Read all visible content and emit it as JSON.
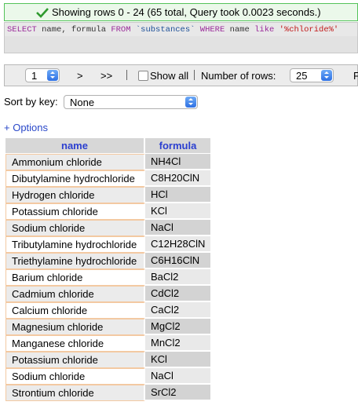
{
  "success": {
    "message": "Showing rows 0 - 24 (65 total, Query took 0.0023 seconds.)"
  },
  "sql": {
    "k_select": "SELECT",
    "fields": " name, formula ",
    "k_from": "FROM",
    "table": " `substances` ",
    "k_where": "WHERE",
    "col": " name ",
    "k_like": "like",
    "pattern": " '%chloride%'"
  },
  "nav": {
    "page": "1",
    "next": ">",
    "last": ">>",
    "show_all": "Show all",
    "rows_label": "Number of rows:",
    "rows_value": "25",
    "cut_label": "F"
  },
  "sort": {
    "label": "Sort by key:",
    "value": "None"
  },
  "options_link": "+ Options",
  "table": {
    "headers": [
      "name",
      "formula"
    ],
    "rows": [
      [
        "Ammonium chloride",
        "NH4Cl"
      ],
      [
        "Dibutylamine hydrochloride",
        "C8H20ClN"
      ],
      [
        "Hydrogen chloride",
        "HCl"
      ],
      [
        "Potassium chloride",
        "KCl"
      ],
      [
        "Sodium chloride",
        "NaCl"
      ],
      [
        "Tributylamine hydrochloride",
        "C12H28ClN"
      ],
      [
        "Triethylamine hydrochloride",
        "C6H16ClN"
      ],
      [
        "Barium chloride",
        "BaCl2"
      ],
      [
        "Cadmium chloride",
        "CdCl2"
      ],
      [
        "Calcium chloride",
        "CaCl2"
      ],
      [
        "Magnesium chloride",
        "MgCl2"
      ],
      [
        "Manganese chloride",
        "MnCl2"
      ],
      [
        "Potassium chloride",
        "KCl"
      ],
      [
        "Sodium chloride",
        "NaCl"
      ],
      [
        "Strontium chloride",
        "SrCl2"
      ]
    ]
  }
}
